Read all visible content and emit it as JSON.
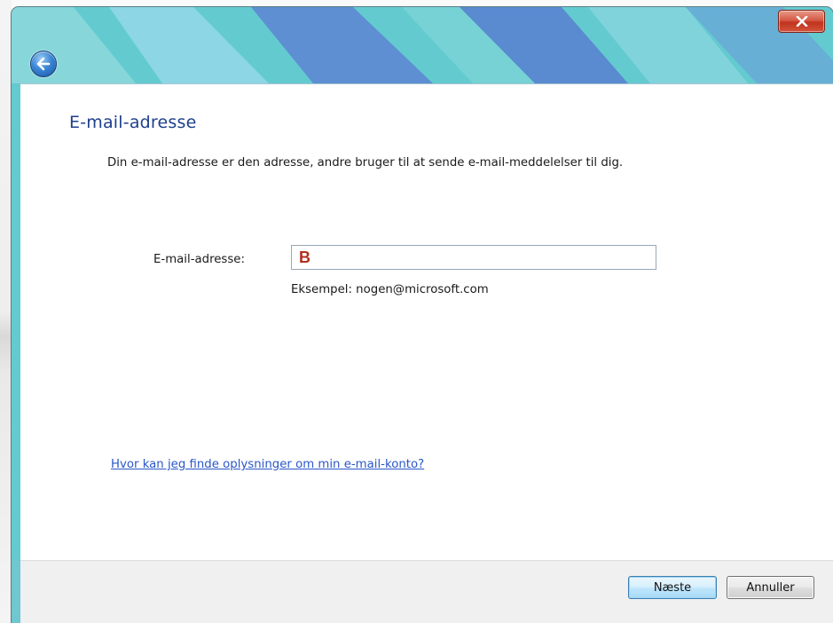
{
  "window": {
    "close_symbol": "x",
    "accent_color": "#5fc8cc",
    "close_color": "#c1341f"
  },
  "navigation": {
    "back_icon": "back-arrow-icon"
  },
  "main": {
    "title": "E-mail-adresse",
    "description": "Din e-mail-adresse er den adresse, andre bruger til at sende e-mail-meddelelser til dig.",
    "email_label": "E-mail-adresse:",
    "email_value": "B",
    "example": "Eksempel: nogen@microsoft.com",
    "help_link": "Hvor kan jeg finde oplysninger om min e-mail-konto?"
  },
  "footer": {
    "next_label": "Næste",
    "cancel_label": "Annuller"
  }
}
